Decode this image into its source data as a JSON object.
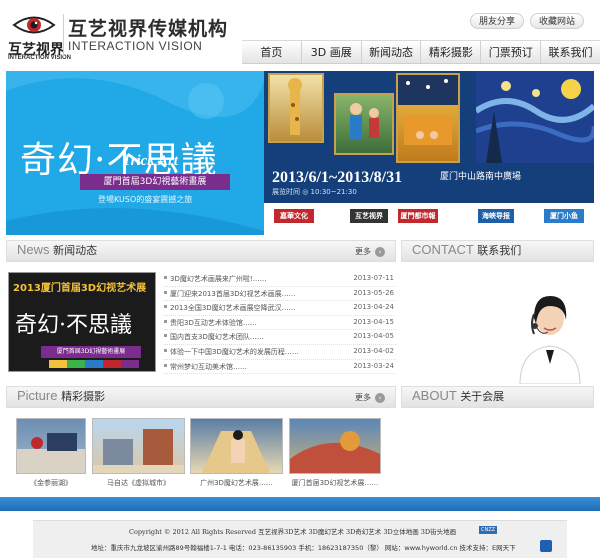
{
  "header": {
    "logo_small_cn": "互艺视界",
    "logo_small_en": "INTERACTION VISION",
    "brand_cn": "互艺视界传媒机构",
    "brand_en": "INTERACTION VISION",
    "top_links": [
      "朋友分享",
      "收藏网站"
    ]
  },
  "nav": [
    "首页",
    "3D 画展",
    "新闻动态",
    "精彩摄影",
    "门票预订",
    "联系我们"
  ],
  "banner": {
    "headline": "奇幻·不思議",
    "trick_art": "Trick Art",
    "tag": "厦門首屆3D幻視藝術畫展",
    "subtitle": "登場KUSO的盛宴震撼之旅",
    "date": "2013/6/1~2013/8/31",
    "venue": "厦门中山路南中廣場",
    "time": "展览时间 ◎ 10:30~21:30",
    "sponsors": [
      "嘉華文化",
      "互艺视界",
      "厦門都市報",
      "海峡导报",
      "厦门小鱼"
    ]
  },
  "news": {
    "title_en": "News",
    "title_cn": "新闻动态",
    "more": "更多",
    "thumb_line": "2013厦门首届3D幻视艺术展",
    "thumb_big": "奇幻·不思議",
    "thumb_tag": "厦門首屆3D幻視藝術畫展",
    "items": [
      {
        "title": "3D魔幻艺术画展来广州啦!……",
        "date": "2013-07-11"
      },
      {
        "title": "厦门迎来2013首届3D幻视艺术画展……",
        "date": "2013-05-26"
      },
      {
        "title": "2013全国3D魔幻艺术画展空降武汉……",
        "date": "2013-04-24"
      },
      {
        "title": "贵阳3D互动艺术体验馆……",
        "date": "2013-04-15"
      },
      {
        "title": "国内首支3D魔幻艺术团队……",
        "date": "2013-04-05"
      },
      {
        "title": "体验一下中国3D魔幻艺术的发展历程……",
        "date": "2013-04-02"
      },
      {
        "title": "常州梦幻互动美术馆……",
        "date": "2013-03-24"
      }
    ]
  },
  "contact": {
    "title_en": "CONTACT",
    "title_cn": "联系我们"
  },
  "pictures": {
    "title_en": "Picture",
    "title_cn": "精彩摄影",
    "more": "更多",
    "captions": [
      "《金参丽湖》",
      "马自达《虚拟城市》",
      "广州3D魔幻艺术展……",
      "厦门首届3D幻视艺术展……"
    ]
  },
  "about": {
    "title_en": "ABOUT",
    "title_cn": "关于会展"
  },
  "footer": {
    "copyright": "Copyright © 2012 All Rights Reserved 互艺视界3D艺术 3D魔幻艺术 3D奇幻艺术 3D立体地画 3D街头地画",
    "cnzz": "CNZZ",
    "address": "地址：重庆市九龙坡区渝州路89号翰福楼1-7-1 电话：023-86135903 手机：18623187350（黎） 网站：www.hyworld.cn 技术支持：E网天下"
  }
}
